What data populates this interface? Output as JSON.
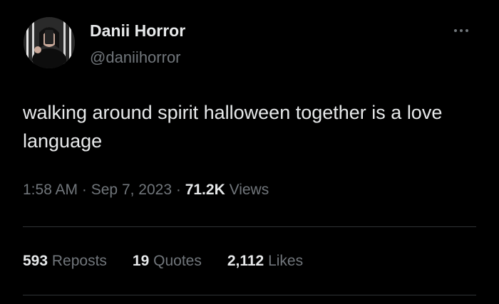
{
  "author": {
    "display_name": "Danii Horror",
    "handle": "@daniihorror"
  },
  "tweet": {
    "text": "walking around spirit halloween together is a love language"
  },
  "meta": {
    "time": "1:58 AM",
    "separator": "·",
    "date": "Sep 7, 2023",
    "views_count": "71.2K",
    "views_label": "Views"
  },
  "stats": {
    "reposts_count": "593",
    "reposts_label": "Reposts",
    "quotes_count": "19",
    "quotes_label": "Quotes",
    "likes_count": "2,112",
    "likes_label": "Likes"
  },
  "icons": {
    "more": "more-horizontal-icon"
  },
  "colors": {
    "background": "#000000",
    "primary_text": "#e7e9ea",
    "secondary_text": "#71767b",
    "divider": "#2f3336"
  }
}
